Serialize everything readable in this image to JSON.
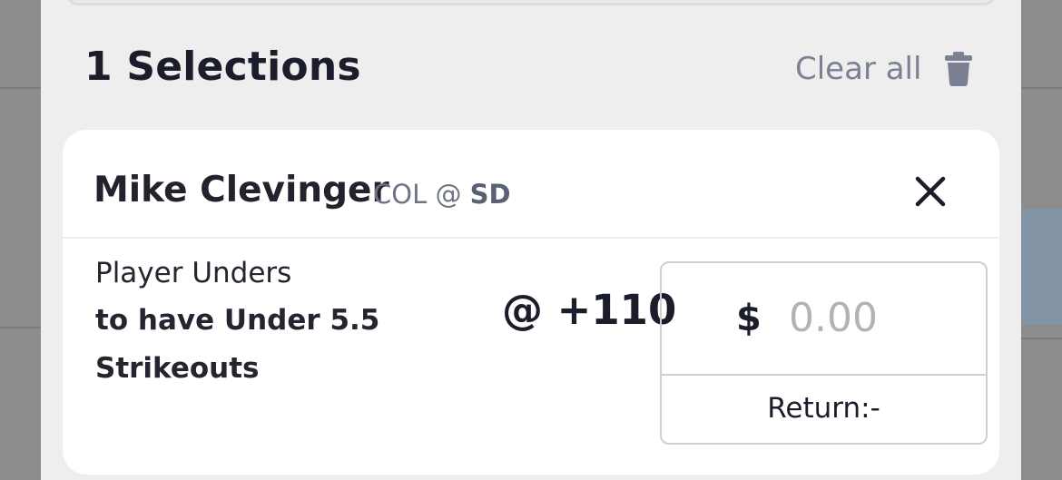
{
  "slip": {
    "title": "1 Selections",
    "clear_all_label": "Clear all",
    "icons": {
      "clear": "trash-icon",
      "remove": "close-icon"
    }
  },
  "selection": {
    "player": "Mike Clevinger",
    "matchup_away": "COL",
    "matchup_at": "@",
    "matchup_home": "SD",
    "bet_type": "Player Unders",
    "bet_description": "to have Under 5.5 Strikeouts",
    "odds": "@ +110",
    "currency_symbol": "$",
    "stake_placeholder": "0.00",
    "stake_value": "",
    "return_text": "Return:-"
  },
  "colors": {
    "sheet_bg": "#eeeeee",
    "card_bg": "#ffffff",
    "primary_text": "#1c1d2b",
    "muted_text": "#7b8092",
    "placeholder_text": "#b3b3b3"
  }
}
